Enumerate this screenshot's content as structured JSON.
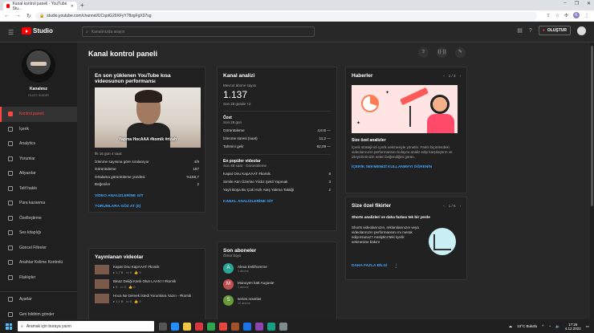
{
  "browser": {
    "tab_title": "Kanal kontrol paneli - YouTube Stu...",
    "url": "studio.youtube.com/channel/UCqotG29XFyY78zgFgX07sg",
    "profile_initial": "K"
  },
  "header": {
    "logo_text": "Studio",
    "search_placeholder": "Kanalınızda arayın",
    "create_label": "OLUŞTUR"
  },
  "sidebar": {
    "channel_name": "Kanalınız",
    "channel_handle": "OUZCI KADIR",
    "items": [
      {
        "label": "Kontrol paneli",
        "active": true
      },
      {
        "label": "İçerik"
      },
      {
        "label": "Analytics"
      },
      {
        "label": "Yorumlar"
      },
      {
        "label": "Altyazılar"
      },
      {
        "label": "Telif hakkı"
      },
      {
        "label": "Para kazanma"
      },
      {
        "label": "Özelleştirme"
      },
      {
        "label": "Ses kitaplığı"
      },
      {
        "label": "Güncel Filtreler"
      },
      {
        "label": "Anahtar Kelime Kontrolü"
      },
      {
        "label": "Flaklıpler"
      }
    ],
    "bottom_items": [
      {
        "label": "Ayarlar"
      },
      {
        "label": "Geri bildirim gönder"
      }
    ]
  },
  "main": {
    "title": "Kanal kontrol paneli",
    "latest_short": {
      "title": "En son yüklenen YouTube kısa videosunun performansı",
      "thumbnail_caption": "Yapma HocAAA #komik #rizah",
      "meta": "İlk 16 gün 4 saat:",
      "rows": [
        {
          "label": "İzlenme sayısına göre sıralanıyor",
          "value": "4/9"
        },
        {
          "label": "Görüntüleme",
          "value": "187"
        },
        {
          "label": "Ortalama görüntüleme yüzdesi",
          "value": "%158,7"
        },
        {
          "label": "Beğeniler",
          "value": "2"
        }
      ],
      "link1": "VİDEO ANALİZLERİNE GİT",
      "link2": "YORUMLARA GÖZ AT (0)"
    },
    "analytics": {
      "title": "Kanal analizi",
      "subs_label": "Mevcut abone sayısı",
      "subs_value": "1.137",
      "subs_change": "Son 28 günde +2",
      "summary_title": "Özet",
      "summary_period": "Son 28 gün",
      "summary_rows": [
        {
          "label": "Görüntüleme",
          "value": "4,6 B",
          "trend": "—"
        },
        {
          "label": "İzlenme süresi (saat)",
          "value": "11,2",
          "trend": "—"
        },
        {
          "label": "Tahmini gelir",
          "value": "62,09",
          "trend": "—"
        }
      ],
      "top_title": "En popüler videolar",
      "top_period": "Son 48 saat · Görüntüleme",
      "top_rows": [
        {
          "label": "Kapat Onu KapAAAT #komik",
          "value": "8"
        },
        {
          "label": "Simile Atın Üzerine Yıldız Şekli Yapmak",
          "value": "3"
        },
        {
          "label": "Yaylı Boşa Bu Çok Hızlı Ateş Yakma Taktiği",
          "value": "2"
        }
      ],
      "link": "KANAL ANALİZLERİNE GİT"
    },
    "news": {
      "title": "Haberler",
      "pager": "1 / 3",
      "headline": "Size özel analizler",
      "body": "İçerik stratejinizi içerik sekmesiyle yönetin. Farklı biçimlerdeki videolarınızın performansını kolayca analiz edip karşılaştırın ve izleyicilerinizin neleri beğendiğini görün.",
      "link": "İÇERİK SEKMENİZİ KULLANMAYI ÖĞRENİN"
    },
    "ideas": {
      "title": "Size özel fikirler",
      "pager": "1 / 5",
      "headline": "Shorts analizleri ve daha fazlası tek bir yerde",
      "body": "Shorts videolarınızın, reklamlarınızın veya videolarınızın performansını mı merak ediyorsunuz? Analytics'teki İçerik sekmesine bakın!",
      "link": "DAHA FAZLA BİLGİ"
    },
    "published": {
      "title": "Yayınlanan videolar",
      "items": [
        {
          "title": "Kapat Onu KapAAAT #komik",
          "views": "1,7 B",
          "comments": "0",
          "likes": "9"
        },
        {
          "title": "Binaz Deliği Kanlı Olun LAAN !! #komik",
          "views": "9",
          "comments": "0",
          "likes": "0"
        },
        {
          "title": "Hoca Ne Demek İstedi Yorumlara Yazın - #komik",
          "views": "1,1 B",
          "comments": "0",
          "likes": "2"
        }
      ]
    },
    "subscribers": {
      "title": "Son aboneler",
      "period": "Ömür boyu",
      "items": [
        {
          "initial": "A",
          "name": "Alexa Estilhomme",
          "meta": "1 abone",
          "color": "#2ba59a"
        },
        {
          "initial": "M",
          "name": "Manuyen katt Auguste",
          "meta": "1 abone",
          "color": "#c05050"
        },
        {
          "initial": "S",
          "name": "series novelas",
          "meta": "12 abone",
          "color": "#6a9a3a"
        }
      ]
    }
  },
  "taskbar": {
    "search_placeholder": "Aramak için buraya yazın",
    "weather": "13°C Bulutlu",
    "time": "17:26",
    "date": "4.12.2022"
  }
}
